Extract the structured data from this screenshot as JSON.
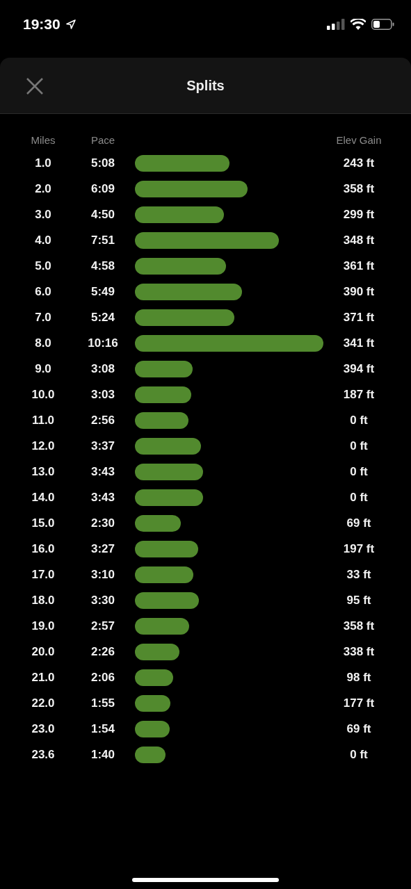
{
  "status_bar": {
    "time": "19:30"
  },
  "header": {
    "title": "Splits"
  },
  "columns": [
    "Miles",
    "Pace",
    "Elev Gain"
  ],
  "splits": [
    {
      "miles": "1.0",
      "pace": "5:08",
      "elev_gain": "243 ft"
    },
    {
      "miles": "2.0",
      "pace": "6:09",
      "elev_gain": "358 ft"
    },
    {
      "miles": "3.0",
      "pace": "4:50",
      "elev_gain": "299 ft"
    },
    {
      "miles": "4.0",
      "pace": "7:51",
      "elev_gain": "348 ft"
    },
    {
      "miles": "5.0",
      "pace": "4:58",
      "elev_gain": "361 ft"
    },
    {
      "miles": "6.0",
      "pace": "5:49",
      "elev_gain": "390 ft"
    },
    {
      "miles": "7.0",
      "pace": "5:24",
      "elev_gain": "371 ft"
    },
    {
      "miles": "8.0",
      "pace": "10:16",
      "elev_gain": "341 ft"
    },
    {
      "miles": "9.0",
      "pace": "3:08",
      "elev_gain": "394 ft"
    },
    {
      "miles": "10.0",
      "pace": "3:03",
      "elev_gain": "187 ft"
    },
    {
      "miles": "11.0",
      "pace": "2:56",
      "elev_gain": "0 ft"
    },
    {
      "miles": "12.0",
      "pace": "3:37",
      "elev_gain": "0 ft"
    },
    {
      "miles": "13.0",
      "pace": "3:43",
      "elev_gain": "0 ft"
    },
    {
      "miles": "14.0",
      "pace": "3:43",
      "elev_gain": "0 ft"
    },
    {
      "miles": "15.0",
      "pace": "2:30",
      "elev_gain": "69 ft"
    },
    {
      "miles": "16.0",
      "pace": "3:27",
      "elev_gain": "197 ft"
    },
    {
      "miles": "17.0",
      "pace": "3:10",
      "elev_gain": "33 ft"
    },
    {
      "miles": "18.0",
      "pace": "3:30",
      "elev_gain": "95 ft"
    },
    {
      "miles": "19.0",
      "pace": "2:57",
      "elev_gain": "358 ft"
    },
    {
      "miles": "20.0",
      "pace": "2:26",
      "elev_gain": "338 ft"
    },
    {
      "miles": "21.0",
      "pace": "2:06",
      "elev_gain": "98 ft"
    },
    {
      "miles": "22.0",
      "pace": "1:55",
      "elev_gain": "177 ft"
    },
    {
      "miles": "23.0",
      "pace": "1:54",
      "elev_gain": "69 ft"
    },
    {
      "miles": "23.6",
      "pace": "1:40",
      "elev_gain": "0 ft"
    }
  ]
}
